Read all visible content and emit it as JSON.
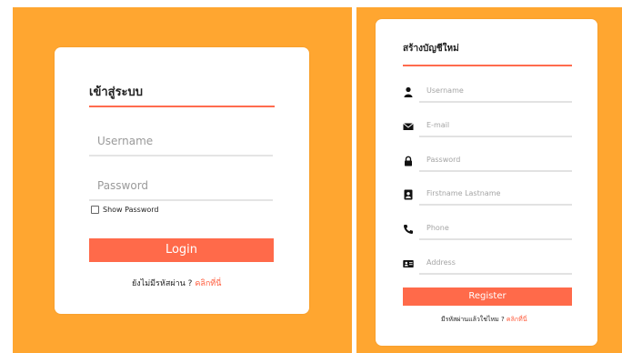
{
  "login": {
    "title": "เข้าสู่ระบบ",
    "username_placeholder": "Username",
    "password_placeholder": "Password",
    "show_password_label": "Show Password",
    "button_label": "Login",
    "footer_text": "ยังไม่มีรหัสผ่าน ? ",
    "footer_link": "คลิกที่นี่"
  },
  "register": {
    "title": "สร้างบัญชีใหม่",
    "fields": [
      {
        "icon": "user-icon",
        "placeholder": "Username"
      },
      {
        "icon": "envelope-icon",
        "placeholder": "E-mail"
      },
      {
        "icon": "lock-icon",
        "placeholder": "Password"
      },
      {
        "icon": "contact-card-icon",
        "placeholder": "Firstname Lastname"
      },
      {
        "icon": "phone-icon",
        "placeholder": "Phone"
      },
      {
        "icon": "address-card-icon",
        "placeholder": "Address"
      }
    ],
    "button_label": "Register",
    "footer_text": "มีรหัสผ่านแล้วใช่ไหม ? ",
    "footer_link": "คลิกที่นี่"
  },
  "colors": {
    "background": "#ffa630",
    "accent": "#ff6a4a",
    "card": "#ffffff"
  }
}
